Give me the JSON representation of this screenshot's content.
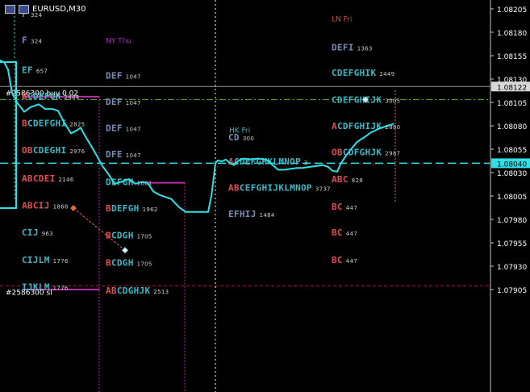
{
  "window": {
    "symbol_timeframe": "EURUSD,M30"
  },
  "colors": {
    "background": "#000000",
    "price_line": "#2fe0e6",
    "axis_text": "#ffffff",
    "bid_label_bg": "#2fe0e6",
    "position_label_bg": "#d8d8d8",
    "sl_line": "#c0103a",
    "tp_line": "#4fa820",
    "trade_line": "#e46060",
    "poc_line": "#b52ea8",
    "vline": "#ffffff"
  },
  "chart_data": {
    "type": "line",
    "ylim": [
      1.0789,
      1.0825
    ],
    "y_ticks": [
      "1.08205",
      "1.08180",
      "1.08155",
      "1.08130",
      "1.08105",
      "1.08080",
      "1.08055",
      "1.08030",
      "1.08005",
      "1.07980",
      "1.07955",
      "1.07930",
      "1.07905"
    ],
    "price_labels": [
      {
        "text": "1.08122",
        "value": 1.08122,
        "style": "position"
      },
      {
        "text": "1.08040",
        "value": 1.0804,
        "style": "bid"
      }
    ],
    "series": [
      {
        "points": [
          [
            0,
            1.0815
          ],
          [
            5,
            1.08148
          ],
          [
            10,
            1.0814
          ],
          [
            15,
            1.08115
          ],
          [
            22,
            1.08104
          ],
          [
            30,
            1.08095
          ],
          [
            38,
            1.081
          ],
          [
            48,
            1.08103
          ],
          [
            56,
            1.08098
          ],
          [
            65,
            1.08098
          ],
          [
            72,
            1.08096
          ],
          [
            80,
            1.08083
          ],
          [
            88,
            1.08072
          ],
          [
            95,
            1.08075
          ],
          [
            100,
            1.08078
          ],
          [
            105,
            1.0807
          ],
          [
            112,
            1.0806
          ],
          [
            120,
            1.08048
          ],
          [
            127,
            1.08037
          ],
          [
            134,
            1.08029
          ],
          [
            142,
            1.08018
          ],
          [
            150,
            1.0802
          ],
          [
            160,
            1.08023
          ],
          [
            168,
            1.08018
          ],
          [
            176,
            1.0802
          ],
          [
            183,
            1.08019
          ],
          [
            190,
            1.0801
          ],
          [
            198,
            1.08006
          ],
          [
            205,
            1.08004
          ],
          [
            212,
            1.08002
          ],
          [
            222,
            1.07993
          ],
          [
            230,
            1.07988
          ],
          [
            240,
            1.07988
          ],
          [
            250,
            1.07988
          ],
          [
            258,
            1.07988
          ],
          [
            262,
            1.08005
          ],
          [
            265,
            1.08025
          ],
          [
            267,
            1.0804
          ],
          [
            270,
            1.08043
          ],
          [
            275,
            1.08042
          ],
          [
            280,
            1.08044
          ],
          [
            285,
            1.0804
          ],
          [
            290,
            1.08038
          ],
          [
            296,
            1.08043
          ],
          [
            302,
            1.08045
          ],
          [
            310,
            1.08044
          ],
          [
            320,
            1.08045
          ],
          [
            330,
            1.08044
          ],
          [
            338,
            1.08038
          ],
          [
            345,
            1.08033
          ],
          [
            352,
            1.08033
          ],
          [
            360,
            1.08034
          ],
          [
            368,
            1.08035
          ],
          [
            375,
            1.08035
          ],
          [
            383,
            1.08036
          ],
          [
            392,
            1.08037
          ],
          [
            400,
            1.08038
          ],
          [
            407,
            1.08036
          ],
          [
            412,
            1.08032
          ],
          [
            418,
            1.08031
          ],
          [
            422,
            1.08039
          ],
          [
            428,
            1.08047
          ],
          [
            435,
            1.08055
          ],
          [
            443,
            1.08063
          ],
          [
            452,
            1.08068
          ],
          [
            460,
            1.08073
          ],
          [
            470,
            1.08077
          ],
          [
            480,
            1.0808
          ],
          [
            488,
            1.08082
          ]
        ]
      }
    ],
    "hlines": [
      {
        "value": 1.08122,
        "style": "solid-gray"
      },
      {
        "value": 1.0804,
        "style": "bid-dash"
      },
      {
        "value": 1.08108,
        "style": "tp-dashdot"
      },
      {
        "value": 1.07909,
        "style": "sl-dash"
      }
    ],
    "vlines": [
      {
        "x": 267
      }
    ],
    "line_labels": [
      {
        "text": "#2586300 buy 0.02",
        "value": 1.08122
      },
      {
        "text": "#2586300 sl",
        "value": 1.07909
      }
    ],
    "session_labels": [
      {
        "text": "LN Fri",
        "x": 411,
        "value": 1.08195,
        "color": "#e8502a"
      },
      {
        "text": "NY Thu",
        "x": 131,
        "value": 1.08172,
        "color": "#b02aa8"
      },
      {
        "text": "HK Fri",
        "x": 284,
        "value": 1.08076,
        "color": "#3cb9c8"
      }
    ],
    "tpo_profiles": [
      {
        "x": 27,
        "rows": [
          {
            "letters": "F",
            "count": "324",
            "value": 1.082,
            "color": "#7a8db8"
          },
          {
            "letters": "F",
            "count": "324",
            "value": 1.08172,
            "color": "#7a8db8"
          },
          {
            "letters": "EF",
            "count": "657",
            "value": 1.0814,
            "color": "#3cb9c8"
          },
          {
            "letters": "BCDEFGH",
            "count": "2484",
            "value": 1.08112,
            "color": "#3cb9c8",
            "accent": "B"
          },
          {
            "letters": "BCDEFGHI",
            "count": "2825",
            "value": 1.08083,
            "color": "#3cb9c8",
            "accent": "B"
          },
          {
            "letters": "OBCDEGHI",
            "count": "2976",
            "value": 1.08054,
            "color": "#3cb9c8",
            "accent": "OB"
          },
          {
            "letters": "ABCDEI",
            "count": "2146",
            "value": 1.08024,
            "color": "#e05050"
          },
          {
            "letters": "ABCIJ",
            "count": "1868",
            "value": 1.07995,
            "color": "#e05050"
          },
          {
            "letters": "CIJ",
            "count": "963",
            "value": 1.07966,
            "color": "#3cb9c8"
          },
          {
            "letters": "CIJLM",
            "count": "1776",
            "value": 1.07937,
            "color": "#3cb9c8"
          },
          {
            "letters": "IJKLM",
            "count": "1776",
            "value": 1.07908,
            "color": "#3cb9c8"
          }
        ]
      },
      {
        "x": 131,
        "rows": [
          {
            "letters": "DEF",
            "count": "1047",
            "value": 1.08134,
            "color": "#7a8db8"
          },
          {
            "letters": "DEF",
            "count": "1047",
            "value": 1.08106,
            "color": "#7a8db8"
          },
          {
            "letters": "DEF",
            "count": "1047",
            "value": 1.08078,
            "color": "#7a8db8"
          },
          {
            "letters": "DFE",
            "count": "1047",
            "value": 1.0805,
            "color": "#7a8db8"
          },
          {
            "letters": "DEFGH",
            "count": "1601",
            "value": 1.0802,
            "color": "#3cb9c8"
          },
          {
            "letters": "BDEFGH",
            "count": "1962",
            "value": 1.07992,
            "color": "#3cb9c8",
            "accent": "B"
          },
          {
            "letters": "BCDGH",
            "count": "1705",
            "value": 1.07963,
            "color": "#3cb9c8",
            "accent": "B"
          },
          {
            "letters": "BCDGH",
            "count": "1705",
            "value": 1.07934,
            "color": "#3cb9c8",
            "accent": "B"
          },
          {
            "letters": "ABCDGHJK",
            "count": "2513",
            "value": 1.07904,
            "color": "#3cb9c8",
            "accent": "AB"
          }
        ]
      },
      {
        "x": 283,
        "rows": [
          {
            "letters": "CD",
            "count": "300",
            "value": 1.08068,
            "color": "#7a8db8"
          },
          {
            "letters": "ACDEFGHKLMNOP",
            "count": "3",
            "value": 1.08042,
            "color": "#3cb9c8",
            "accent": "A"
          },
          {
            "letters": "ABCEFGHIJKLMNOP",
            "count": "3737",
            "value": 1.08014,
            "color": "#3cb9c8",
            "accent": "AB"
          },
          {
            "letters": "EFHIJ",
            "count": "1484",
            "value": 1.07986,
            "color": "#7a8db8"
          }
        ]
      },
      {
        "x": 411,
        "rows": [
          {
            "letters": "DEFI",
            "count": "1363",
            "value": 1.08164,
            "color": "#7a8db8"
          },
          {
            "letters": "CDEFGHIK",
            "count": "2449",
            "value": 1.08137,
            "color": "#3cb9c8"
          },
          {
            "letters": "CDEFGHIJK",
            "count": "3005",
            "value": 1.08108,
            "color": "#3cb9c8"
          },
          {
            "letters": "ACDFGHIJK",
            "count": "2880",
            "value": 1.0808,
            "color": "#3cb9c8",
            "accent": "A"
          },
          {
            "letters": "OBCDFGHJK",
            "count": "2987",
            "value": 1.08052,
            "color": "#3cb9c8",
            "accent": "OB"
          },
          {
            "letters": "ABC",
            "count": "828",
            "value": 1.08023,
            "color": "#e05050"
          },
          {
            "letters": "BC",
            "count": "447",
            "value": 1.07994,
            "color": "#e05050"
          },
          {
            "letters": "BC",
            "count": "447",
            "value": 1.07966,
            "color": "#e05050"
          },
          {
            "letters": "BC",
            "count": "447",
            "value": 1.07937,
            "color": "#e05050"
          }
        ]
      }
    ],
    "markers": [
      {
        "x": 91,
        "value": 1.07992,
        "color": "#e86a3a"
      },
      {
        "x": 155,
        "value": 1.07947,
        "color": "#cfefff"
      },
      {
        "x": 453,
        "value": 1.08108,
        "color": "#cfefff"
      }
    ]
  }
}
